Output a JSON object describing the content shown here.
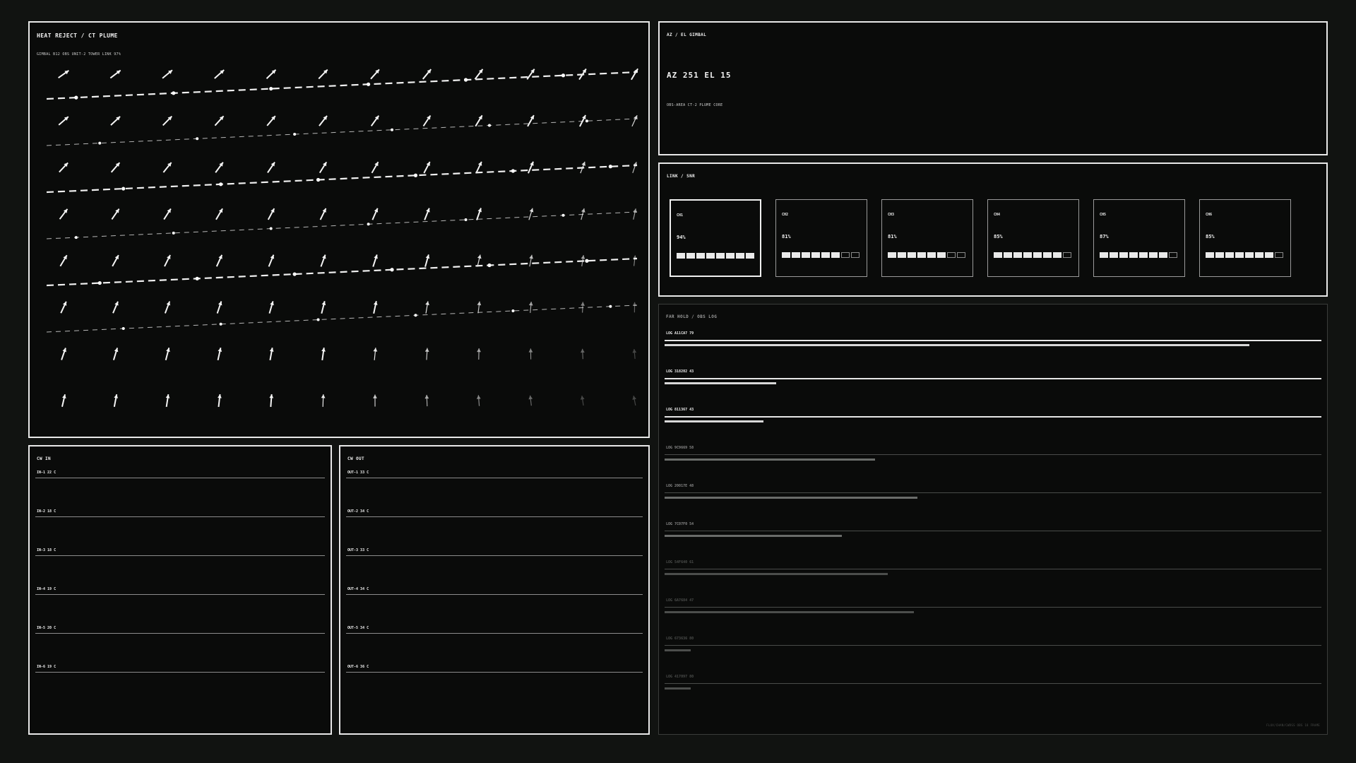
{
  "plume": {
    "title": "HEAT REJECT / CT PLUME",
    "subtitle": "GIMBAL B12 OBS UNIT-2 TOWER LINK 97%",
    "rows": 8,
    "cols": 12,
    "streamlines": 6
  },
  "gimbal": {
    "title": "AZ / EL GIMBAL",
    "readout": "AZ 251  EL 15",
    "obs_area": "OBS-AREA  CT-2  PLUME CORE"
  },
  "link": {
    "title": "LINK / SNR",
    "channels": [
      {
        "name": "CH1",
        "value": "94%",
        "level": 0.94,
        "active": true
      },
      {
        "name": "CH2",
        "value": "81%",
        "level": 0.81,
        "active": false
      },
      {
        "name": "CH3",
        "value": "81%",
        "level": 0.81,
        "active": false
      },
      {
        "name": "CH4",
        "value": "85%",
        "level": 0.85,
        "active": false
      },
      {
        "name": "CH5",
        "value": "87%",
        "level": 0.87,
        "active": false
      },
      {
        "name": "CH6",
        "value": "85%",
        "level": 0.85,
        "active": false
      }
    ]
  },
  "cw_in": {
    "title": "CW IN",
    "rows": [
      "IN-1  22 C",
      "IN-2  18 C",
      "IN-3  18 C",
      "IN-4  19 C",
      "IN-5  20 C",
      "IN-6  19 C"
    ]
  },
  "cw_out": {
    "title": "CW OUT",
    "rows": [
      "OUT-1  33 C",
      "OUT-2  34 C",
      "OUT-3  33 C",
      "OUT-4  34 C",
      "OUT-5  34 C",
      "OUT-6  36 C"
    ]
  },
  "log": {
    "title": "FAR HOLD / OBS LOG",
    "entries": [
      {
        "label": "LOG A11CA7 79",
        "level": 0.89
      },
      {
        "label": "LOG 318202 43",
        "level": 0.17
      },
      {
        "label": "LOG 811367 43",
        "level": 0.15
      },
      {
        "label": "LOG 9C9669 58",
        "level": 0.32
      },
      {
        "label": "LOG 20017E 48",
        "level": 0.385
      },
      {
        "label": "LOG 7C07F0 54",
        "level": 0.27
      },
      {
        "label": "LOG 54F640 61",
        "level": 0.34
      },
      {
        "label": "LOG 6A7684 47",
        "level": 0.38
      },
      {
        "label": "LOG 673636 80",
        "level": 0.04
      },
      {
        "label": "LOG 417097 80",
        "level": 0.04
      }
    ],
    "footer": "FLUX/CHAN/CWDSS  OBS 18 FRAME"
  },
  "colors": {
    "background": "#111311",
    "panel": "#0a0b0a",
    "foreground": "#f2f2f2",
    "dim": "#5a5c5a"
  }
}
